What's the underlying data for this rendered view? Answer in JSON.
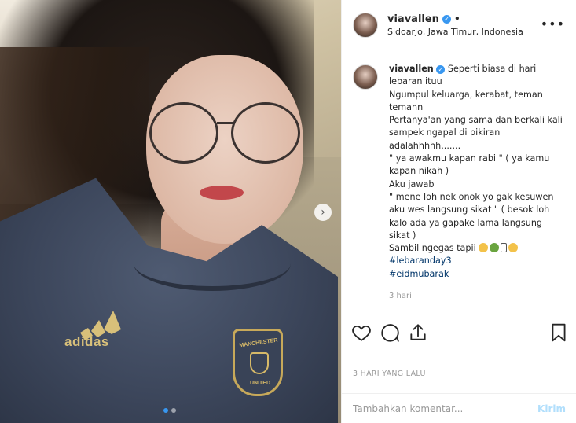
{
  "post": {
    "username": "viavallen",
    "verified": true,
    "separator": "•",
    "location": "Sidoarjo, Jawa Timur, Indonesia",
    "more_label": "•••"
  },
  "caption": {
    "username": "viavallen",
    "lines": [
      "Seperti biasa di hari lebaran ituu",
      "Ngumpul keluarga, kerabat, teman temann",
      "Pertanya'an yang sama dan berkali kali sampek ngapal di pikiran adalahhhhh.......",
      "\" ya awakmu kapan rabi \" ( ya kamu kapan nikah )",
      "Aku jawab",
      "\" mene loh nek onok yo gak kesuwen aku wes langsung sikat \" ( besok loh kalo ada ya gapake lama langsung sikat )",
      "Sambil ngegas tapii"
    ],
    "hashtags": [
      "#lebaranday3",
      "#eidmubarak"
    ],
    "time": "3 hari"
  },
  "photo": {
    "jersey_brand": "adidas",
    "crest_top": "MANCHESTER",
    "crest_bottom": "UNITED",
    "carousel": {
      "count": 2,
      "active": 1
    }
  },
  "actions": {
    "icons": [
      "heart-icon",
      "comment-icon",
      "share-icon",
      "bookmark-icon"
    ],
    "posted": "3 HARI YANG LALU"
  },
  "comment": {
    "placeholder": "Tambahkan komentar...",
    "post_label": "Kirim"
  },
  "colors": {
    "verified": "#3897f0",
    "hashtag": "#003569",
    "muted": "#999999",
    "post_button": "#b2dffc"
  }
}
